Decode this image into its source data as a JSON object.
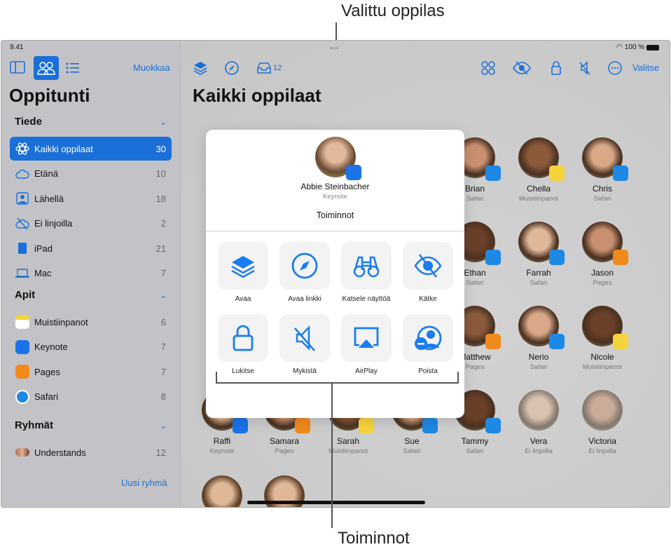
{
  "callouts": {
    "top": "Valittu oppilas",
    "bottom": "Toiminnot"
  },
  "status": {
    "time": "9.41",
    "battery": "100 %"
  },
  "sidebar": {
    "edit": "Muokkaa",
    "title": "Oppitunti",
    "sections": [
      {
        "title": "Tiede",
        "items": [
          {
            "label": "Kaikki oppilaat",
            "count": "30",
            "icon": "atom-icon",
            "selected": true
          },
          {
            "label": "Etänä",
            "count": "10",
            "icon": "cloud-person-icon"
          },
          {
            "label": "Lähellä",
            "count": "18",
            "icon": "person-square-icon"
          },
          {
            "label": "Ei linjoilla",
            "count": "2",
            "icon": "cloud-slash-icon"
          },
          {
            "label": "iPad",
            "count": "21",
            "icon": "ipad-icon"
          },
          {
            "label": "Mac",
            "count": "7",
            "icon": "laptop-icon"
          }
        ]
      },
      {
        "title": "Apit",
        "items": [
          {
            "label": "Muistiinpanot",
            "count": "6",
            "icon": "notes-app-icon"
          },
          {
            "label": "Keynote",
            "count": "7",
            "icon": "keynote-app-icon"
          },
          {
            "label": "Pages",
            "count": "7",
            "icon": "pages-app-icon"
          },
          {
            "label": "Safari",
            "count": "8",
            "icon": "safari-app-icon"
          }
        ]
      },
      {
        "title": "Ryhmät",
        "items": [
          {
            "label": "Understands",
            "count": "12",
            "icon": "group-avatars-icon"
          }
        ]
      }
    ],
    "new_group": "Uusi ryhmä"
  },
  "toolbar": {
    "inbox_count": "12",
    "select": "Valitse"
  },
  "main": {
    "title": "Kaikki oppilaat"
  },
  "students": [
    {
      "name": "Brian",
      "app": "Safari"
    },
    {
      "name": "Chella",
      "app": "Muistiinpanot"
    },
    {
      "name": "Chris",
      "app": "Safari"
    },
    {
      "name": "Ethan",
      "app": "Safari"
    },
    {
      "name": "Farrah",
      "app": "Safari"
    },
    {
      "name": "Jason",
      "app": "Pages"
    },
    {
      "name": "Matthew",
      "app": "Pages"
    },
    {
      "name": "Nerio",
      "app": "Safari"
    },
    {
      "name": "Nicole",
      "app": "Muistiinpanot"
    },
    {
      "name": "Raffi",
      "app": "Keynote"
    },
    {
      "name": "Samara",
      "app": "Pages"
    },
    {
      "name": "Sarah",
      "app": "Muistiinpanot"
    },
    {
      "name": "Sue",
      "app": "Safari"
    },
    {
      "name": "Tammy",
      "app": "Safari"
    },
    {
      "name": "Vera",
      "app": "Ei linjoilla"
    },
    {
      "name": "Victoria",
      "app": "Ei linjoilla"
    }
  ],
  "popover": {
    "student_name": "Abbie Steinbacher",
    "student_app": "Keynote",
    "heading": "Toiminnot",
    "actions": [
      {
        "label": "Avaa",
        "icon": "layers-icon"
      },
      {
        "label": "Avaa linkki",
        "icon": "compass-icon"
      },
      {
        "label": "Katsele näyttöä",
        "icon": "binoculars-icon"
      },
      {
        "label": "Kätke",
        "icon": "eye-slash-icon"
      },
      {
        "label": "Lukitse",
        "icon": "lock-icon"
      },
      {
        "label": "Mykistä",
        "icon": "speaker-slash-icon"
      },
      {
        "label": "AirPlay",
        "icon": "airplay-icon"
      },
      {
        "label": "Poista",
        "icon": "person-remove-icon"
      }
    ]
  },
  "colors": {
    "accent": "#1a6fd8",
    "safari": "#1e88e5",
    "pages": "#f08a1c",
    "keynote": "#1a73e8",
    "notes": "#f5d33b"
  }
}
